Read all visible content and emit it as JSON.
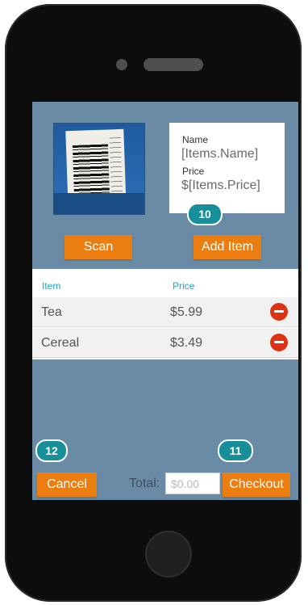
{
  "scan_panel": {
    "name_label": "Name",
    "name_value": "[Items.Name]",
    "price_label": "Price",
    "price_value": "$[Items.Price]",
    "badge": "10"
  },
  "buttons": {
    "scan": "Scan",
    "add_item": "Add Item",
    "cancel": "Cancel",
    "checkout": "Checkout"
  },
  "list": {
    "headers": {
      "item": "Item",
      "price": "Price"
    },
    "rows": [
      {
        "item": "Tea",
        "price": "$5.99"
      },
      {
        "item": "Cereal",
        "price": "$3.49"
      }
    ]
  },
  "footer": {
    "total_label": "Total:",
    "total_value": "$0.00",
    "badge_cancel": "12",
    "badge_checkout": "11"
  },
  "colors": {
    "screen_background": "#6a8ba5",
    "button_orange": "#ec7d11",
    "badge_teal": "#168f9b",
    "header_text": "#1ea5c6",
    "remove_red": "#de3312"
  },
  "icons": [
    "camera-icon",
    "speaker-icon",
    "home-button-icon",
    "remove-icon"
  ]
}
